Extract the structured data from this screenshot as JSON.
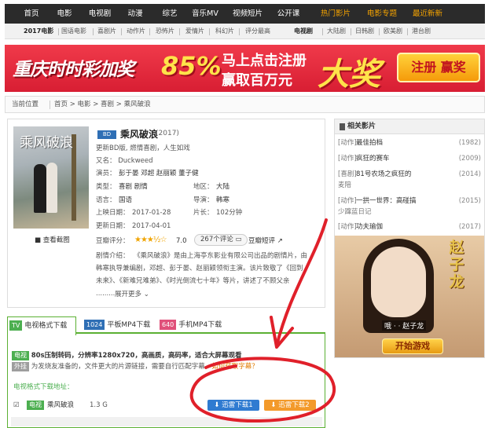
{
  "nav": {
    "items": [
      "首页",
      "电影",
      "电视剧",
      "动漫",
      "综艺",
      "音乐MV",
      "视频短片",
      "公开课"
    ],
    "hot": [
      "热门影片",
      "电影专题",
      "最近新新"
    ]
  },
  "subnav": {
    "left": [
      "2017电影",
      "国语电影",
      "喜剧片",
      "动作片",
      "恐怖片",
      "爱情片",
      "科幻片",
      "评分最高"
    ],
    "right": [
      "电视剧",
      "大陆剧",
      "日韩剧",
      "欧美剧",
      "港台剧"
    ]
  },
  "banner": {
    "line1": "重庆时时彩加奖",
    "pct": "85%",
    "line2": "马上点击注册",
    "line3": "赢取百万元",
    "big": "大奖",
    "button": "注册 赢奖"
  },
  "breadcrumb": {
    "label": "当前位置",
    "path": "首页 > 电影 > 喜剧 > 乘风破浪"
  },
  "movie": {
    "poster_title": "乘风破浪",
    "screenshot_link": "查看截图",
    "badge": "BD",
    "title": "乘风破浪",
    "year": "(2017)",
    "update": "更新BD版, 燃情喜剧，人生如戏",
    "alias": "又名：  Duckweed",
    "actors_label": "演员：",
    "actors": "彭于晏  邓超  赵丽颖  董子健",
    "type_label": "类型：",
    "type": "喜剧  剧情",
    "region_label": "地区：",
    "region": "大陆",
    "lang_label": "语言：",
    "lang": "国语",
    "director_label": "导演：",
    "director": "韩寒",
    "release_label": "上映日期：",
    "release": "2017-01-28",
    "length_label": "片长：",
    "length": "102分钟",
    "updated_label": "更新日期：",
    "updated": "2017-04-01",
    "rating_label": "豆瓣评分：",
    "rating_stars": 3.5,
    "rating": "7.0",
    "comments": "267个评论",
    "douban_review": "豆瓣短评",
    "synopsis_label": "剧情介绍：",
    "synopsis1": "《乘风破浪》是由上海亭东影业有限公司出品的剧情片，由",
    "synopsis2": "韩寒执导兼编剧，邓超、彭于晏、赵丽颖领衔主演。该片致敬了《回到",
    "synopsis3": "未来》、《新难兄难弟》、《时光倒流七十年》等片，讲述了不顾父亲",
    "synopsis4": ".........",
    "expand": "展开更多"
  },
  "download": {
    "tabs": [
      {
        "badge": "TV",
        "label": "电视格式下载",
        "color": "#4caf50"
      },
      {
        "badge": "1024",
        "label": "平板MP4下载",
        "color": "#2f6fb5"
      },
      {
        "badge": "640",
        "label": "手机MP4下载",
        "color": "#e0507a"
      }
    ],
    "line1_badge": "电视",
    "line1": "80s压制转码，分辨率1280x720，高画质，高码率，适合大屏幕观看",
    "line2_badge": "外挂",
    "line2": "为发烧友准备的，文件更大的片源链接，需要自行匹配字幕，",
    "how_subs": "如何获取字幕？",
    "section_title": "电视格式下载地址：",
    "row_badge": "电视",
    "row_name": "乘风破浪",
    "row_size": "1.3 G",
    "btn1": "迅雷下载1",
    "btn2": "迅雷下载2"
  },
  "sidebar": {
    "title": "相关影片",
    "items": [
      {
        "cat": "[动作]",
        "name": "最佳拍档",
        "year": "(1982)"
      },
      {
        "cat": "[动作]",
        "name": "疯狂的赛车",
        "year": "(2009)"
      },
      {
        "cat": "[喜剧]",
        "name": "81号农场之疯狂的",
        "name2": "麦陪",
        "year": "(2014)"
      },
      {
        "cat": "[动作]",
        "name": "一拱一世界：高碰搞",
        "name2": "少蹿蓝日记",
        "year": "(2015)"
      },
      {
        "cat": "[动作]",
        "name": "功夫瑜伽",
        "year": "(2017)"
      }
    ],
    "ad": {
      "name": "赵子龙",
      "caption": "哦 · · 赵子龙",
      "play": "开始游戏"
    }
  },
  "colors": {
    "nav_bg": "#2b2b2b",
    "hot": "#f5a300",
    "green": "#5bb033",
    "annotation": "#e0202a"
  }
}
